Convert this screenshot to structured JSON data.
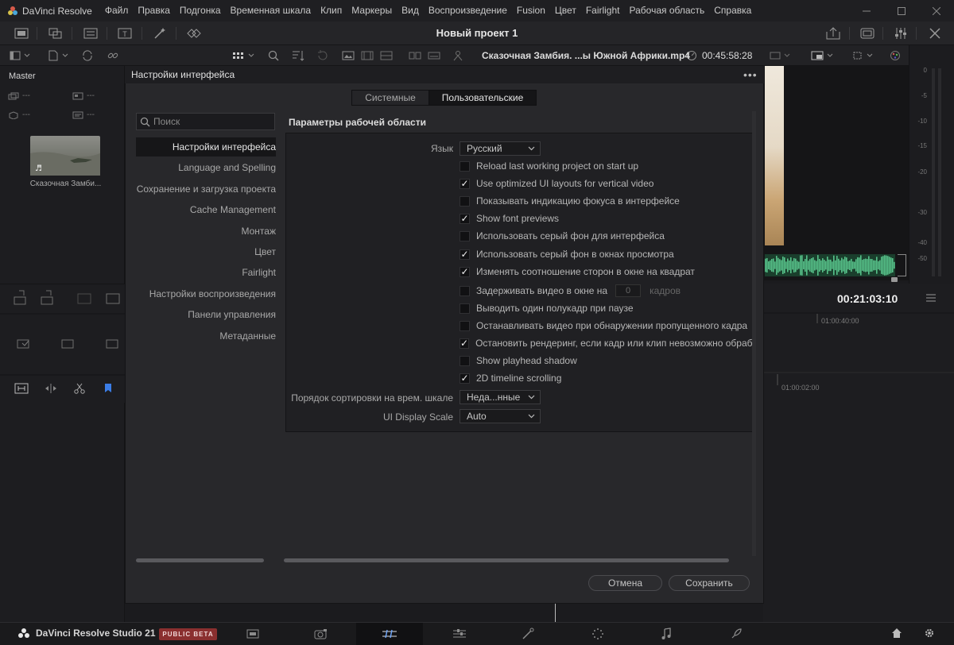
{
  "menubar": {
    "app_name": "DaVinci Resolve",
    "items": [
      "Файл",
      "Правка",
      "Подгонка",
      "Временная шкала",
      "Клип",
      "Маркеры",
      "Вид",
      "Воспроизведение",
      "Fusion",
      "Цвет",
      "Fairlight",
      "Рабочая область",
      "Справка"
    ]
  },
  "toolbar": {
    "project_title": "Новый проект 1"
  },
  "viewer": {
    "clip_name": "Сказочная Замбия. ...ы Южной Африки.mp4",
    "timecode": "00:45:58:28"
  },
  "media_pool": {
    "bin": "Master",
    "placeholder": "---",
    "clip_label": "Сказочная Замби..."
  },
  "timeline": {
    "timecode": "00:21:03:10",
    "ruler_1": "01:00:40:00",
    "ruler_2": "01:00:02:00"
  },
  "meter": {
    "labels": [
      "0",
      "-5",
      "-10",
      "-15",
      "-20",
      "-30",
      "-40",
      "-50"
    ]
  },
  "dialog": {
    "title": "Настройки интерфейса",
    "menu": "•••",
    "tabs": [
      {
        "label": "Системные",
        "active": false
      },
      {
        "label": "Пользовательские",
        "active": true
      }
    ],
    "search_placeholder": "Поиск",
    "nav": [
      {
        "label": "Настройки интерфейса",
        "active": true
      },
      {
        "label": "Language and Spelling"
      },
      {
        "label": "Сохранение и загрузка проекта"
      },
      {
        "label": "Cache Management"
      },
      {
        "label": "Монтаж"
      },
      {
        "label": "Цвет"
      },
      {
        "label": "Fairlight"
      },
      {
        "label": "Настройки воспроизведения"
      },
      {
        "label": "Панели управления"
      },
      {
        "label": "Метаданные"
      }
    ],
    "section_title": "Параметры рабочей области",
    "language_label": "Язык",
    "language_value": "Русский",
    "options": [
      {
        "label": "Reload last working project on start up",
        "checked": false
      },
      {
        "label": "Use optimized UI layouts for vertical video",
        "checked": true
      },
      {
        "label": "Показывать индикацию фокуса в интерфейсе",
        "checked": false
      },
      {
        "label": "Show font previews",
        "checked": true
      },
      {
        "label": "Использовать серый фон для интерфейса",
        "checked": false
      },
      {
        "label": "Использовать серый фон в окнах просмотра",
        "checked": true
      },
      {
        "label": "Изменять соотношение сторон в окне на квадрат",
        "checked": true
      },
      {
        "label": "Задерживать видео в окне на",
        "checked": false,
        "input": "0",
        "unit": "кадров"
      },
      {
        "label": "Выводить один полукадр при паузе",
        "checked": false
      },
      {
        "label": "Останавливать видео при обнаружении пропущенного кадра",
        "checked": false
      },
      {
        "label": "Остановить рендеринг, если кадр или клип невозможно обработать",
        "checked": true
      },
      {
        "label": "Show playhead shadow",
        "checked": false
      },
      {
        "label": "2D timeline scrolling",
        "checked": true
      }
    ],
    "sort_label": "Порядок сортировки на врем. шкале",
    "sort_value": "Неда...нные",
    "scale_label": "UI Display Scale",
    "scale_value": "Auto",
    "cancel": "Отмена",
    "save": "Сохранить"
  },
  "bottombar": {
    "product": "DaVinci Resolve Studio 21",
    "badge": "PUBLIC BETA"
  },
  "colors": {
    "checkbox_mark": "#f0f0f0",
    "badge": "#8a2f2f",
    "wave": "#57c28a"
  }
}
